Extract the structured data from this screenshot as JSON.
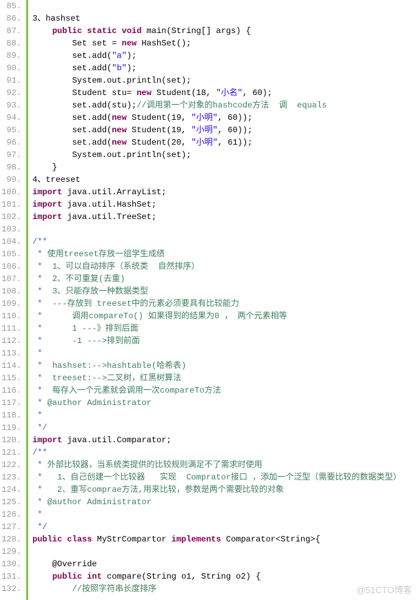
{
  "watermark": "@51CTO博客",
  "startLine": 85,
  "lines": [
    {
      "n": 85,
      "t": []
    },
    {
      "n": 86,
      "t": [
        {
          "c": "plain",
          "v": "3、hashset"
        }
      ]
    },
    {
      "n": 87,
      "t": [
        {
          "c": "plain",
          "v": "    "
        },
        {
          "c": "kw",
          "v": "public"
        },
        {
          "c": "plain",
          "v": " "
        },
        {
          "c": "kw",
          "v": "static"
        },
        {
          "c": "plain",
          "v": " "
        },
        {
          "c": "kw",
          "v": "void"
        },
        {
          "c": "plain",
          "v": " main(String[] args) {"
        }
      ]
    },
    {
      "n": 88,
      "t": [
        {
          "c": "plain",
          "v": "        Set set = "
        },
        {
          "c": "kw",
          "v": "new"
        },
        {
          "c": "plain",
          "v": " HashSet();"
        }
      ]
    },
    {
      "n": 89,
      "t": [
        {
          "c": "plain",
          "v": "        set.add("
        },
        {
          "c": "str",
          "v": "\"a\""
        },
        {
          "c": "plain",
          "v": ");"
        }
      ]
    },
    {
      "n": 90,
      "t": [
        {
          "c": "plain",
          "v": "        set.add("
        },
        {
          "c": "str",
          "v": "\"b\""
        },
        {
          "c": "plain",
          "v": ");"
        }
      ]
    },
    {
      "n": 91,
      "t": [
        {
          "c": "plain",
          "v": "        System.out.println(set);"
        }
      ]
    },
    {
      "n": 92,
      "t": [
        {
          "c": "plain",
          "v": "        Student stu= "
        },
        {
          "c": "kw",
          "v": "new"
        },
        {
          "c": "plain",
          "v": " Student(18, "
        },
        {
          "c": "str",
          "v": "\"小名\""
        },
        {
          "c": "plain",
          "v": ", 60);"
        }
      ]
    },
    {
      "n": 93,
      "t": [
        {
          "c": "plain",
          "v": "        set.add(stu);"
        },
        {
          "c": "com",
          "v": "//调用第一个对象的hashcode方法  调  equals"
        }
      ]
    },
    {
      "n": 94,
      "t": [
        {
          "c": "plain",
          "v": "        set.add("
        },
        {
          "c": "kw",
          "v": "new"
        },
        {
          "c": "plain",
          "v": " Student(19, "
        },
        {
          "c": "str",
          "v": "\"小明\""
        },
        {
          "c": "plain",
          "v": ", 60));"
        }
      ]
    },
    {
      "n": 95,
      "t": [
        {
          "c": "plain",
          "v": "        set.add("
        },
        {
          "c": "kw",
          "v": "new"
        },
        {
          "c": "plain",
          "v": " Student(19, "
        },
        {
          "c": "str",
          "v": "\"小明\""
        },
        {
          "c": "plain",
          "v": ", 60));"
        }
      ]
    },
    {
      "n": 96,
      "t": [
        {
          "c": "plain",
          "v": "        set.add("
        },
        {
          "c": "kw",
          "v": "new"
        },
        {
          "c": "plain",
          "v": " Student(20, "
        },
        {
          "c": "str",
          "v": "\"小明\""
        },
        {
          "c": "plain",
          "v": ", 61));"
        }
      ]
    },
    {
      "n": 97,
      "t": [
        {
          "c": "plain",
          "v": "        System.out.println(set);"
        }
      ]
    },
    {
      "n": 98,
      "t": [
        {
          "c": "plain",
          "v": "    }"
        }
      ]
    },
    {
      "n": 99,
      "t": [
        {
          "c": "plain",
          "v": "4、treeset"
        }
      ]
    },
    {
      "n": 100,
      "t": [
        {
          "c": "kw",
          "v": "import"
        },
        {
          "c": "plain",
          "v": " java.util.ArrayList;"
        }
      ]
    },
    {
      "n": 101,
      "t": [
        {
          "c": "kw",
          "v": "import"
        },
        {
          "c": "plain",
          "v": " java.util.HashSet;"
        }
      ]
    },
    {
      "n": 102,
      "t": [
        {
          "c": "kw",
          "v": "import"
        },
        {
          "c": "plain",
          "v": " java.util.TreeSet;"
        }
      ]
    },
    {
      "n": 103,
      "t": []
    },
    {
      "n": 104,
      "t": [
        {
          "c": "doc",
          "v": "/**"
        }
      ]
    },
    {
      "n": 105,
      "t": [
        {
          "c": "doc",
          "v": " * "
        },
        {
          "c": "chcom",
          "v": "使用treeset存放一组学生成绩"
        }
      ]
    },
    {
      "n": 106,
      "t": [
        {
          "c": "doc",
          "v": " *  "
        },
        {
          "c": "chcom",
          "v": "1、可以自动排序（系统类  自然排序）"
        }
      ]
    },
    {
      "n": 107,
      "t": [
        {
          "c": "doc",
          "v": " *  "
        },
        {
          "c": "chcom",
          "v": "2、不可重复(去重)"
        }
      ]
    },
    {
      "n": 108,
      "t": [
        {
          "c": "doc",
          "v": " *  "
        },
        {
          "c": "chcom",
          "v": "3、只能存放一种数据类型"
        }
      ]
    },
    {
      "n": 109,
      "t": [
        {
          "c": "doc",
          "v": " *  "
        },
        {
          "c": "chcom",
          "v": "---存放到 treeset中的元素必须要具有比较能力"
        }
      ]
    },
    {
      "n": 110,
      "t": [
        {
          "c": "doc",
          "v": " *      "
        },
        {
          "c": "chcom",
          "v": "调用compareTo() 如果得到的结果为0 ， 两个元素相等"
        }
      ]
    },
    {
      "n": 111,
      "t": [
        {
          "c": "doc",
          "v": " *      "
        },
        {
          "c": "chcom",
          "v": "1 ---》排到后面"
        }
      ]
    },
    {
      "n": 112,
      "t": [
        {
          "c": "doc",
          "v": " *      "
        },
        {
          "c": "chcom",
          "v": "-1 --->排到前面"
        }
      ]
    },
    {
      "n": 113,
      "t": [
        {
          "c": "doc",
          "v": " *"
        }
      ]
    },
    {
      "n": 114,
      "t": [
        {
          "c": "doc",
          "v": " *  "
        },
        {
          "c": "chcom",
          "v": "hashset:-->hashtable(哈希表)"
        }
      ]
    },
    {
      "n": 115,
      "t": [
        {
          "c": "doc",
          "v": " *  "
        },
        {
          "c": "chcom",
          "v": "treeset:-->二叉树，红黑树算法"
        }
      ]
    },
    {
      "n": 116,
      "t": [
        {
          "c": "doc",
          "v": " *  "
        },
        {
          "c": "chcom",
          "v": "每存入一个元素就会调用一次compareTo方法"
        }
      ]
    },
    {
      "n": 117,
      "t": [
        {
          "c": "doc",
          "v": " * "
        },
        {
          "c": "chcom",
          "v": "@author Administrator"
        }
      ]
    },
    {
      "n": 118,
      "t": [
        {
          "c": "doc",
          "v": " *"
        }
      ]
    },
    {
      "n": 119,
      "t": [
        {
          "c": "doc",
          "v": " */"
        }
      ]
    },
    {
      "n": 120,
      "t": [
        {
          "c": "kw",
          "v": "import"
        },
        {
          "c": "plain",
          "v": " java.util.Comparator;"
        }
      ]
    },
    {
      "n": 121,
      "t": [
        {
          "c": "doc",
          "v": "/**"
        }
      ]
    },
    {
      "n": 122,
      "t": [
        {
          "c": "doc",
          "v": " * "
        },
        {
          "c": "chcom",
          "v": "外部比较器，当系统类提供的比较规则满足不了需求时使用"
        }
      ]
    },
    {
      "n": 123,
      "t": [
        {
          "c": "doc",
          "v": " *   "
        },
        {
          "c": "chcom",
          "v": "1、自己创建一个比较器   实现  Comprator接口 ，添加一个泛型（需要比较的数据类型）"
        }
      ]
    },
    {
      "n": 124,
      "t": [
        {
          "c": "doc",
          "v": " *   "
        },
        {
          "c": "chcom",
          "v": "2、重写comprae方法,用来比较，参数是两个需要比较的对象"
        }
      ]
    },
    {
      "n": 125,
      "t": [
        {
          "c": "doc",
          "v": " * "
        },
        {
          "c": "chcom",
          "v": "@author Administrator"
        }
      ]
    },
    {
      "n": 126,
      "t": [
        {
          "c": "doc",
          "v": " *"
        }
      ]
    },
    {
      "n": 127,
      "t": [
        {
          "c": "doc",
          "v": " */"
        }
      ]
    },
    {
      "n": 128,
      "t": [
        {
          "c": "kw",
          "v": "public"
        },
        {
          "c": "plain",
          "v": " "
        },
        {
          "c": "kw",
          "v": "class"
        },
        {
          "c": "plain",
          "v": " MyStrCompartor "
        },
        {
          "c": "kw",
          "v": "implements"
        },
        {
          "c": "plain",
          "v": " Comparator<String>{"
        }
      ]
    },
    {
      "n": 129,
      "t": []
    },
    {
      "n": 130,
      "t": [
        {
          "c": "plain",
          "v": "    @Override"
        }
      ]
    },
    {
      "n": 131,
      "t": [
        {
          "c": "plain",
          "v": "    "
        },
        {
          "c": "kw",
          "v": "public"
        },
        {
          "c": "plain",
          "v": " "
        },
        {
          "c": "kw",
          "v": "int"
        },
        {
          "c": "plain",
          "v": " compare(String o1, String o2) {"
        }
      ]
    },
    {
      "n": 132,
      "t": [
        {
          "c": "plain",
          "v": "        "
        },
        {
          "c": "com",
          "v": "//按照字符串长度排序"
        }
      ]
    }
  ]
}
